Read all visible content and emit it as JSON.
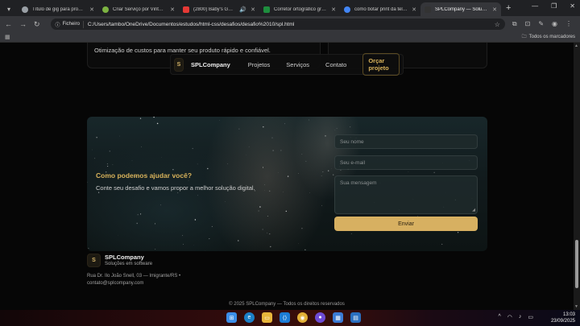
{
  "browser": {
    "tabs": [
      {
        "title": "Título de gig para program",
        "color": "#9aa0a6"
      },
      {
        "title": "Criar Serviço por VintePila",
        "color": "#7cb342"
      },
      {
        "title": "(2800) Baby's Got Har",
        "color": "#e53935"
      },
      {
        "title": "Corretor ortográfico gratu",
        "color": "#1e8e3e"
      },
      {
        "title": "como botar print da tela d",
        "color": "#4285f4"
      },
      {
        "title": "SPLCompany — Soluçõe",
        "color": "#333333"
      }
    ],
    "address_chip": "Ficheiro",
    "url": "C:/Users/tambo/OneDrive/Documentos/estudos/html-css/desafios/desafio%2010/spl.html",
    "all_bookmarks": "Todos os marcadores"
  },
  "page": {
    "top_card_text": "Otimização de custos para manter seu produto rápido e confiável.",
    "nav": {
      "logo_letter": "S",
      "brand": "SPLCompany",
      "links": [
        "Projetos",
        "Serviços",
        "Contato"
      ],
      "cta": "Orçar projeto"
    },
    "contact": {
      "title": "Como podemos ajudar você?",
      "subtitle": "Conte seu desafio e vamos propor a melhor solução digital.",
      "name_placeholder": "Seu nome",
      "email_placeholder": "Seu e-mail",
      "message_placeholder": "Sua mensagem",
      "send_label": "Enviar"
    },
    "footer": {
      "logo_letter": "S",
      "brand": "SPLCompany",
      "tagline": "Soluções em software",
      "address": "Rua Dr. Ilo João Snell, 03 — Imigrante/RS •",
      "email": "contato@splcompany.com",
      "copyright": "© 2025 SPLCompany — Todos os direitos reservados"
    }
  },
  "taskbar": {
    "time": "13:03",
    "date": "23/09/2025"
  },
  "colors": {
    "accent_gold": "#d7b061",
    "background": "#060606"
  }
}
